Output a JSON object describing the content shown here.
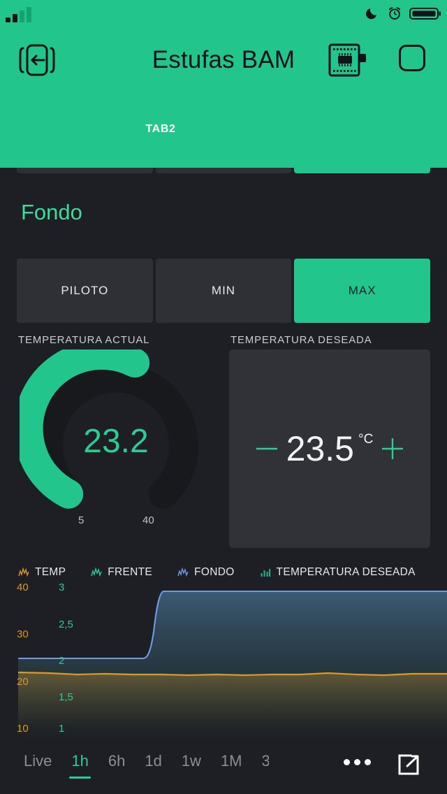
{
  "statusbar": {
    "signal_icon": "signal-bars-icon",
    "moon_icon": "moon-icon",
    "alarm_icon": "alarm-clock-icon",
    "battery_icon": "battery-full-icon"
  },
  "header": {
    "title": "Estufas BAM",
    "back_icon": "exit-left-icon",
    "device_icon": "chip-icon",
    "square_icon": "rounded-square-icon",
    "accent_color": "#22c68c",
    "tabs": [
      {
        "label": "TAB2",
        "active": true
      }
    ]
  },
  "peek_row": {
    "buttons": [
      {
        "label": "",
        "active": false
      },
      {
        "label": "",
        "active": false
      },
      {
        "label": "",
        "active": true
      }
    ]
  },
  "section": {
    "title": "Fondo",
    "title_color": "#3ddc9a",
    "modes": [
      {
        "label": "PILOTO",
        "active": false
      },
      {
        "label": "MIN",
        "active": false
      },
      {
        "label": "MAX",
        "active": true
      }
    ]
  },
  "current": {
    "label": "TEMPERATURA ACTUAL",
    "value": "23.2",
    "min_tick": "5",
    "max_tick": "40",
    "arc_color": "#22c68c",
    "track_color": "#17191d"
  },
  "desired": {
    "label": "TEMPERATURA DESEADA",
    "value": "23.5",
    "unit": "°C",
    "minus_label": "−",
    "plus_label": "+",
    "button_color": "#2ecc94"
  },
  "chart_data": {
    "type": "line",
    "title": "",
    "xlabel": "",
    "grid": false,
    "legend_position": "top",
    "legend": [
      {
        "name": "TEMP",
        "icon": "line-chart-icon",
        "color": "#d79a2b"
      },
      {
        "name": "FRENTE",
        "icon": "line-chart-icon",
        "color": "#2ecc94"
      },
      {
        "name": "FONDO",
        "icon": "line-chart-icon",
        "color": "#6e9ee0"
      },
      {
        "name": "TEMPERATURA DESEADA",
        "icon": "bar-chart-icon",
        "color": "#2aa98a"
      }
    ],
    "axes": [
      {
        "name": "temperature",
        "side": "left",
        "color": "#d79a2b",
        "ticks": [
          40,
          30,
          20,
          10
        ],
        "ylim": [
          5,
          45
        ]
      },
      {
        "name": "state",
        "side": "left-2",
        "color": "#2ecc94",
        "ticks": [
          "3",
          "2,5",
          "2",
          "1,5",
          "1"
        ],
        "ylim": [
          0.75,
          3.25
        ]
      }
    ],
    "series": [
      {
        "name": "TEMP",
        "color": "#d79a2b",
        "axis": "temperature",
        "x": [
          0,
          10,
          20,
          30,
          40,
          50,
          60,
          70,
          80,
          90,
          100
        ],
        "values": [
          21.5,
          21.4,
          21.3,
          21.4,
          21.3,
          21.3,
          21.4,
          21.3,
          21.4,
          21.3,
          21.4
        ]
      },
      {
        "name": "FONDO",
        "color": "#6e9ee0",
        "axis": "state",
        "x": [
          0,
          10,
          20,
          28,
          30,
          32,
          34,
          40,
          60,
          80,
          100
        ],
        "values": [
          2.0,
          2.0,
          2.0,
          2.0,
          2.2,
          2.8,
          3.0,
          3.0,
          3.0,
          3.0,
          3.0
        ]
      }
    ]
  },
  "bottom": {
    "ranges": [
      {
        "label": "Live",
        "active": false
      },
      {
        "label": "1h",
        "active": true
      },
      {
        "label": "6h",
        "active": false
      },
      {
        "label": "1d",
        "active": false
      },
      {
        "label": "1w",
        "active": false
      },
      {
        "label": "1M",
        "active": false
      },
      {
        "label": "3",
        "active": false,
        "clipped": true
      }
    ],
    "overflow_icon": "more-dots-icon",
    "expand_icon": "external-link-icon"
  }
}
